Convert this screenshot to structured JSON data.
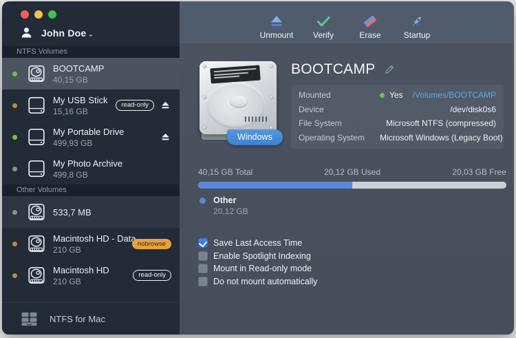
{
  "sidebar": {
    "user_name": "John Doe",
    "user_chevron": "⌄",
    "ntfs_header": "NTFS Volumes",
    "other_header": "Other Volumes",
    "volumes": [
      {
        "name": "BOOTCAMP",
        "size": "40,15 GB",
        "status": "green"
      },
      {
        "name": "My USB Stick",
        "size": "15,16 GB",
        "status": "orange",
        "badge": "read-only"
      },
      {
        "name": "My Portable Drive",
        "size": "499,93 GB",
        "status": "green"
      },
      {
        "name": "My Photo Archive",
        "size": "499,8 GB",
        "status": "gray"
      },
      {
        "name": "",
        "size": "533,7 MB",
        "status": "gray"
      },
      {
        "name": "Macintosh HD - Data",
        "size": "210 GB",
        "status": "orange",
        "badge": "nobrowse"
      },
      {
        "name": "Macintosh HD",
        "size": "210 GB",
        "status": "orange",
        "badge": "read-only"
      }
    ],
    "footer_label": "NTFS for Mac"
  },
  "toolbar": {
    "unmount": "Unmount",
    "verify": "Verify",
    "erase": "Erase",
    "startup": "Startup"
  },
  "main": {
    "volume_title": "BOOTCAMP",
    "os_badge": "Windows",
    "info": {
      "mounted_label": "Mounted",
      "mounted_value": "Yes",
      "mount_point": "/Volumes/BOOTCAMP",
      "device_label": "Device",
      "device_value": "/dev/disk0s6",
      "fs_label": "File System",
      "fs_value": "Microsoft NTFS (compressed)",
      "os_label": "Operating System",
      "os_value": "Microsoft Windows (Legacy Boot)"
    },
    "usage": {
      "total": "40,15 GB Total",
      "used": "20,12 GB Used",
      "free": "20,03 GB Free",
      "used_percent": 50.1,
      "legend_name": "Other",
      "legend_size": "20,12 GB"
    },
    "options": [
      {
        "label": "Save Last Access Time",
        "checked": true
      },
      {
        "label": "Enable Spotlight Indexing",
        "checked": false
      },
      {
        "label": "Mount in Read-only mode",
        "checked": false
      },
      {
        "label": "Do not mount automatically",
        "checked": false
      }
    ]
  },
  "colors": {
    "accent_blue": "#2a6bf0",
    "link_blue": "#55a7f3",
    "bar_blue": "#5b87d7",
    "bar_track": "#ccd1d8",
    "status_green": "#74c145",
    "status_orange": "#bd8b3f",
    "status_gray": "#878e97",
    "badge_nobrowse_bg": "#e9a23b",
    "sidebar_bg": "#232b39",
    "toolbar_bg": "#505c6b",
    "content_bg": "#4a5260"
  }
}
